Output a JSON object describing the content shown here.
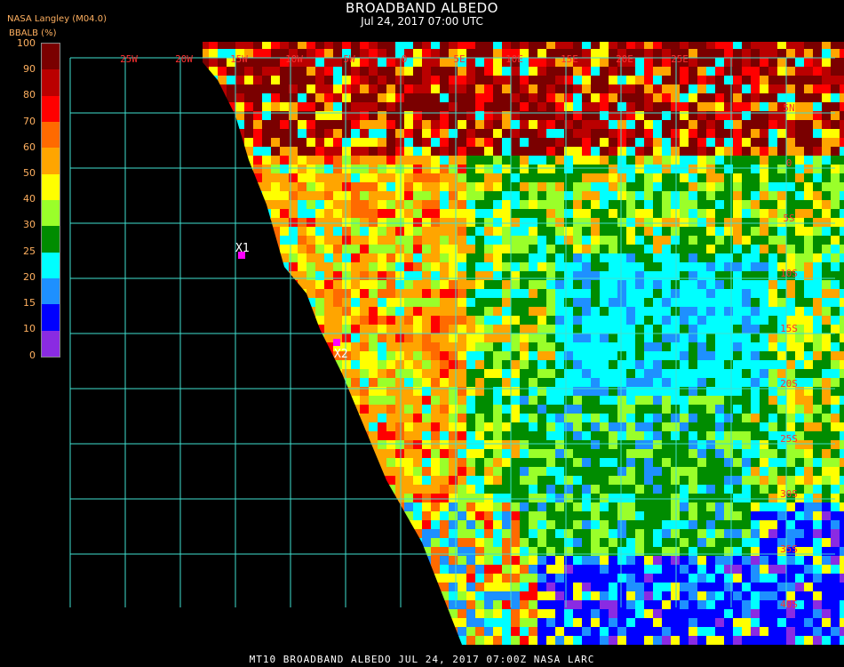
{
  "header": {
    "title": "BROADBAND ALBEDO",
    "subtitle": "Jul 24, 2017 07:00 UTC",
    "source": "NASA Langley (M04.0)",
    "units": "BBALB (%)"
  },
  "colorbar": {
    "labels": [
      "100",
      "90",
      "80",
      "70",
      "60",
      "50",
      "40",
      "30",
      "25",
      "20",
      "15",
      "10",
      "0"
    ],
    "colors": [
      "#7a0000",
      "#ba0000",
      "#ff0000",
      "#ff6a00",
      "#ffa500",
      "#ffff00",
      "#9aff2a",
      "#008c00",
      "#00ffff",
      "#1e90ff",
      "#0000ff",
      "#8a2be2"
    ]
  },
  "map": {
    "lon_labels": [
      "25W",
      "20W",
      "15W",
      "10W",
      "5W",
      "0",
      "5E",
      "10E",
      "15E",
      "20E",
      "25E"
    ],
    "lat_labels": [
      "5N",
      "0",
      "5S",
      "10S",
      "15S",
      "20S",
      "25S",
      "30S",
      "35S",
      "40S"
    ],
    "markers": [
      {
        "label": "X1",
        "color": "#ff00ff"
      },
      {
        "label": "X2",
        "color": "#ff00ff"
      }
    ],
    "grid_color": "#40e0d0"
  },
  "footer": {
    "text": "MT10  BROADBAND ALBEDO   JUL 24, 2017 07:00Z   NASA LARC"
  }
}
